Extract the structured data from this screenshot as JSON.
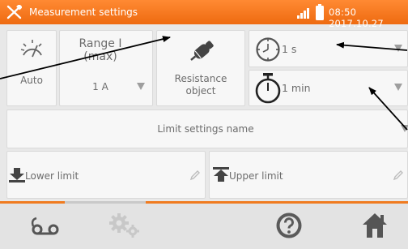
{
  "status_bar": {
    "title": "Measurement settings",
    "time": "08:50",
    "date": "2017.10.27"
  },
  "auto_tile": {
    "label": "Auto"
  },
  "range_tile": {
    "title_line1": "Range I",
    "title_line2": "(max)",
    "value": "1 A"
  },
  "resistance_tile": {
    "label_line1": "Resistance",
    "label_line2": "object"
  },
  "timer1": {
    "value": "1 s"
  },
  "timer2": {
    "value": "1 min"
  },
  "limit_settings": {
    "label": "Limit settings name"
  },
  "lower_limit": {
    "label": "Lower limit"
  },
  "upper_limit": {
    "label": "Upper limit"
  },
  "colors": {
    "accent": "#f07b20",
    "status_bar": "#ee6a10",
    "tile_bg": "#f7f7f7",
    "text": "#6c6c6c",
    "toolbar_icon": "#555555"
  },
  "icons": [
    "tools-icon",
    "signal-icon",
    "battery-icon",
    "auto-range-icon",
    "dropdown-arrow-icon",
    "resistance-object-icon",
    "stopwatch-icon",
    "timer-icon",
    "lower-limit-icon",
    "upper-limit-icon",
    "pencil-icon",
    "measurement-probes-icon",
    "settings-gears-icon",
    "help-icon",
    "home-icon"
  ]
}
